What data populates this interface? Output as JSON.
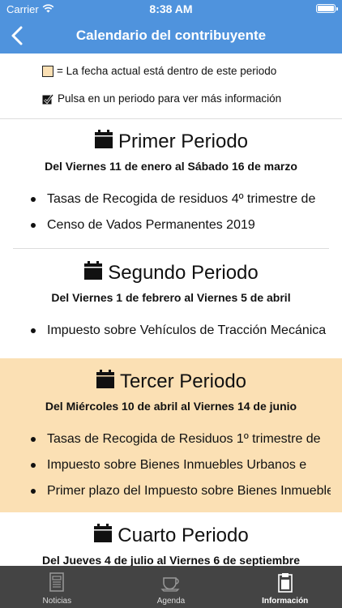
{
  "status_bar": {
    "carrier": "Carrier",
    "time": "8:38 AM"
  },
  "nav": {
    "title": "Calendario del contribuyente"
  },
  "legend": {
    "current_period": "= La fecha actual está dentro de este periodo",
    "tap_info": "Pulsa en un periodo para ver más información"
  },
  "colors": {
    "brand": "#4f93dd",
    "current_period_bg": "#fbe0b4",
    "tab_bar_bg": "#444444"
  },
  "periods": [
    {
      "title": "Primer Periodo",
      "dates": "Del Viernes 11 de enero al Sábado 16 de marzo",
      "items": [
        "Tasas de Recogida de residuos 4º trimestre de",
        "Censo de Vados Permanentes 2019"
      ]
    },
    {
      "title": "Segundo Periodo",
      "dates": "Del Viernes 1 de febrero al Viernes 5 de abril",
      "items": [
        "Impuesto sobre Vehículos de Tracción Mecánica"
      ]
    },
    {
      "title": "Tercer Periodo",
      "dates": "Del Miércoles 10 de abril al Viernes 14 de junio",
      "current": true,
      "items": [
        "Tasas de Recogida de Residuos 1º trimestre de",
        "Impuesto sobre Bienes Inmuebles Urbanos e",
        "Primer plazo del Impuesto sobre Bienes Inmuebles"
      ]
    },
    {
      "title": "Cuarto Periodo",
      "dates": "Del Jueves 4 de julio al Viernes 6 de septiembre"
    }
  ],
  "tabs": [
    {
      "label": "Noticias",
      "icon": "newspaper-icon"
    },
    {
      "label": "Agenda",
      "icon": "coffee-cup-icon"
    },
    {
      "label": "Información",
      "icon": "clipboard-icon",
      "active": true
    }
  ]
}
